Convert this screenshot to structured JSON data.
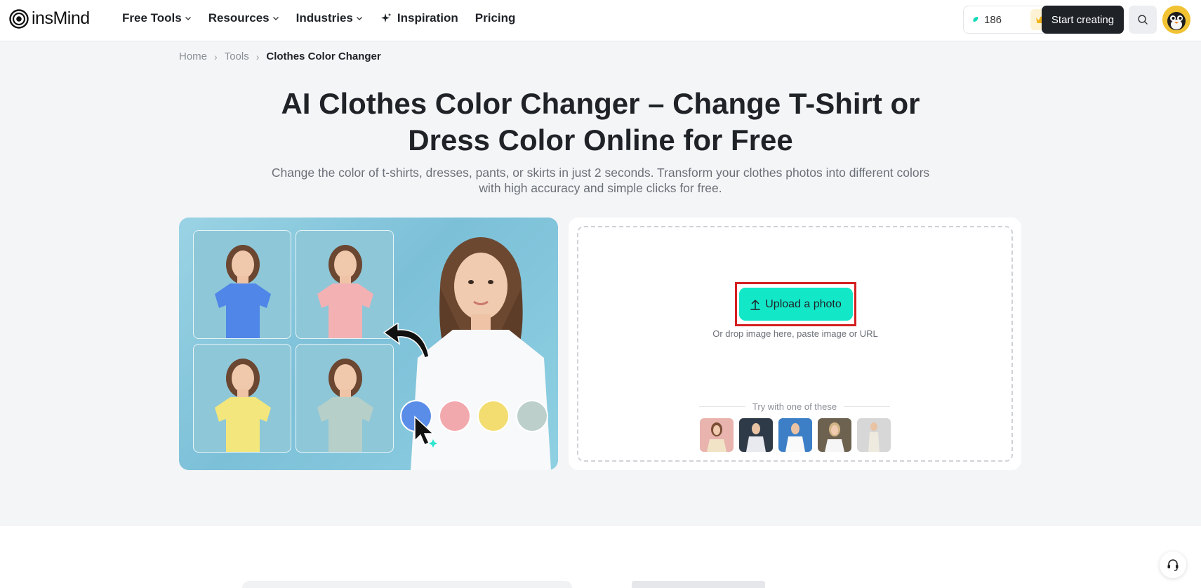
{
  "header": {
    "logo_text": "insMind",
    "nav": [
      {
        "label": "Free Tools",
        "has_dropdown": true
      },
      {
        "label": "Resources",
        "has_dropdown": true
      },
      {
        "label": "Industries",
        "has_dropdown": true
      },
      {
        "label": "Inspiration",
        "icon": "sparkle-icon"
      },
      {
        "label": "Pricing"
      }
    ],
    "credits": "186",
    "start_button": "Start creating"
  },
  "breadcrumb": [
    "Home",
    "Tools",
    "Clothes Color Changer"
  ],
  "hero": {
    "title_line1": "AI Clothes Color Changer – Change T-Shirt or",
    "title_line2": "Dress Color Online for Free",
    "subtitle_line1": "Change the color of t-shirts, dresses, pants, or skirts in just 2 seconds. Transform your clothes photos into different colors",
    "subtitle_line2": "with high accuracy and simple clicks for free."
  },
  "demo": {
    "tshirt_colors": [
      "#4f86e8",
      "#f3b1b4",
      "#f3e67c",
      "#b6cfc9"
    ],
    "swatches": [
      "#5a8de8",
      "#f2a9ad",
      "#f4dd70",
      "#bccfcb"
    ]
  },
  "upload": {
    "button_label": "Upload a photo",
    "hint": "Or drop image here, paste image or URL",
    "try_label": "Try with one of these",
    "accent": "#12e8c8"
  },
  "colors": {
    "brand_dark": "#1f2328",
    "highlight": "#d42020"
  }
}
